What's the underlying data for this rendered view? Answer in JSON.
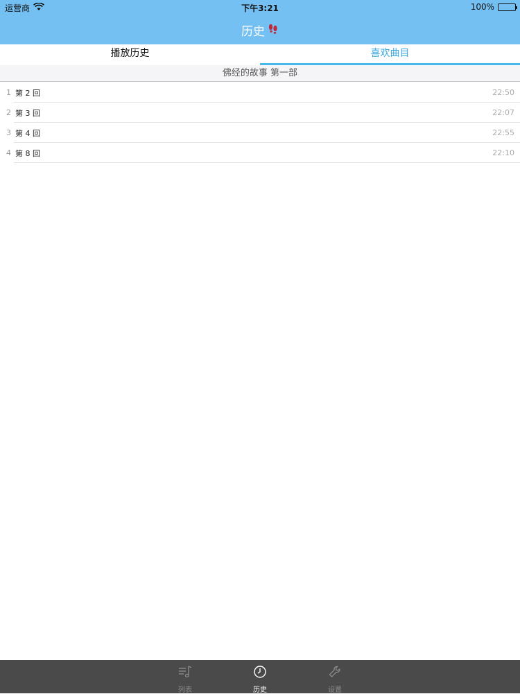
{
  "status_bar": {
    "carrier": "运营商",
    "time": "下午3:21",
    "battery_text": "100%",
    "battery_level": 1.0,
    "wifi_icon": "wifi-icon"
  },
  "nav": {
    "title": "历史",
    "title_icon": "footprints-icon"
  },
  "tabs": [
    {
      "label": "播放历史",
      "selected": false
    },
    {
      "label": "喜欢曲目",
      "selected": true
    }
  ],
  "section": {
    "title": "佛经的故事 第一部"
  },
  "rows": [
    {
      "index": "1",
      "title": "第 2 回",
      "time": "22:50"
    },
    {
      "index": "2",
      "title": "第 3 回",
      "time": "22:07"
    },
    {
      "index": "3",
      "title": "第 4 回",
      "time": "22:55"
    },
    {
      "index": "4",
      "title": "第 8 回",
      "time": "22:10"
    }
  ],
  "tabbar": [
    {
      "label": "列表",
      "icon": "music-list-icon",
      "active": false
    },
    {
      "label": "历史",
      "icon": "clock-icon",
      "active": true
    },
    {
      "label": "设置",
      "icon": "wrench-icon",
      "active": false
    }
  ],
  "colors": {
    "nav_background": "#74c0f2",
    "accent": "#38a7e0",
    "tabbar_background": "#4a4a4a"
  }
}
